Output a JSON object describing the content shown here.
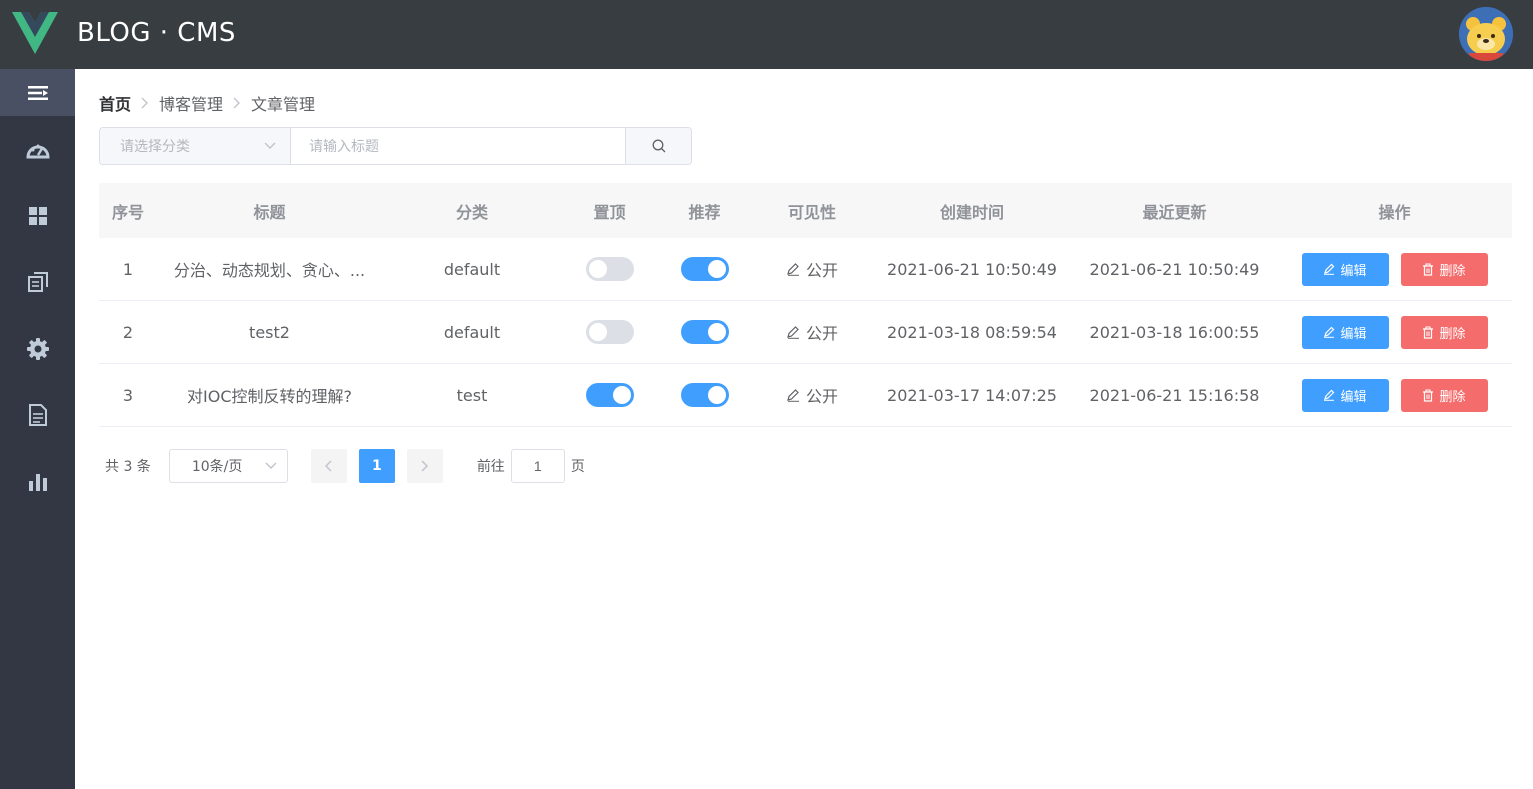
{
  "header": {
    "brand": "BLOG · CMS"
  },
  "breadcrumb": [
    "首页",
    "博客管理",
    "文章管理"
  ],
  "filters": {
    "category_placeholder": "请选择分类",
    "title_placeholder": "请输入标题"
  },
  "table": {
    "columns": [
      "序号",
      "标题",
      "分类",
      "置顶",
      "推荐",
      "可见性",
      "创建时间",
      "最近更新",
      "操作"
    ],
    "rows": [
      {
        "index": "1",
        "title": "分治、动态规划、贪心、...",
        "category": "default",
        "top": false,
        "recommend": true,
        "visibility": "公开",
        "created": "2021-06-21 10:50:49",
        "updated": "2021-06-21 10:50:49"
      },
      {
        "index": "2",
        "title": "test2",
        "category": "default",
        "top": false,
        "recommend": true,
        "visibility": "公开",
        "created": "2021-03-18 08:59:54",
        "updated": "2021-03-18 16:00:55"
      },
      {
        "index": "3",
        "title": "对IOC控制反转的理解?",
        "category": "test",
        "top": true,
        "recommend": true,
        "visibility": "公开",
        "created": "2021-03-17 14:07:25",
        "updated": "2021-06-21 15:16:58"
      }
    ],
    "edit_label": "编辑",
    "delete_label": "删除"
  },
  "pagination": {
    "total_text": "共 3 条",
    "page_size": "10条/页",
    "current_page": "1",
    "goto_label": "前往",
    "goto_value": "1",
    "page_suffix": "页"
  },
  "colors": {
    "primary": "#409eff",
    "danger": "#f56c6c",
    "header_bg": "#373d41",
    "sidebar_bg": "#333744"
  },
  "sidebar": {
    "icons": [
      "menu-toggle-icon",
      "dashboard-icon",
      "grid-icon",
      "copy-icon",
      "gear-icon",
      "document-icon",
      "bar-chart-icon"
    ]
  }
}
